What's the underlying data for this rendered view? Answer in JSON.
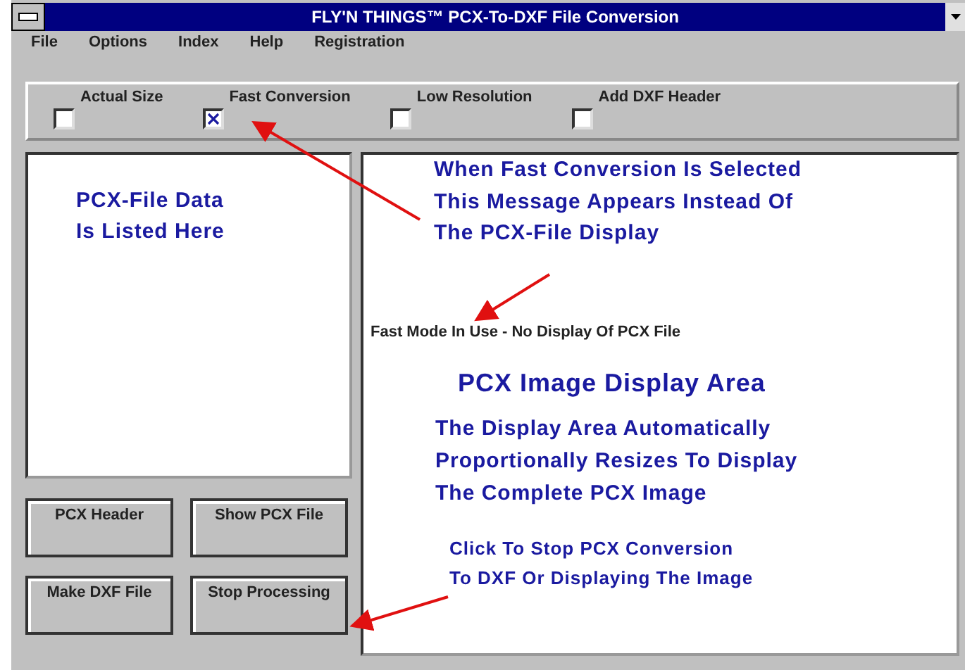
{
  "window": {
    "title": "FLY'N THINGS™ PCX-To-DXF File Conversion"
  },
  "menu": [
    "File",
    "Options",
    "Index",
    "Help",
    "Registration"
  ],
  "options": [
    {
      "label": "Actual Size",
      "checked": false
    },
    {
      "label": "Fast Conversion",
      "checked": true
    },
    {
      "label": "Low Resolution",
      "checked": false
    },
    {
      "label": "Add DXF Header",
      "checked": false
    }
  ],
  "list_panel": {
    "note": [
      "PCX-File Data",
      "Is Listed Here"
    ]
  },
  "buttons": [
    "PCX Header",
    "Show PCX File",
    "Make DXF File",
    "Stop Processing"
  ],
  "display_panel": {
    "note_fast": [
      "When Fast Conversion Is Selected",
      "This Message Appears Instead Of",
      "The PCX-File Display"
    ],
    "status": "Fast Mode In Use - No Display Of PCX File",
    "heading": "PCX Image Display Area",
    "note_resize": [
      "The Display Area Automatically",
      "Proportionally Resizes To Display",
      "The Complete PCX Image"
    ],
    "note_stop": [
      "Click To Stop PCX Conversion",
      "To DXF Or Displaying The Image"
    ]
  }
}
